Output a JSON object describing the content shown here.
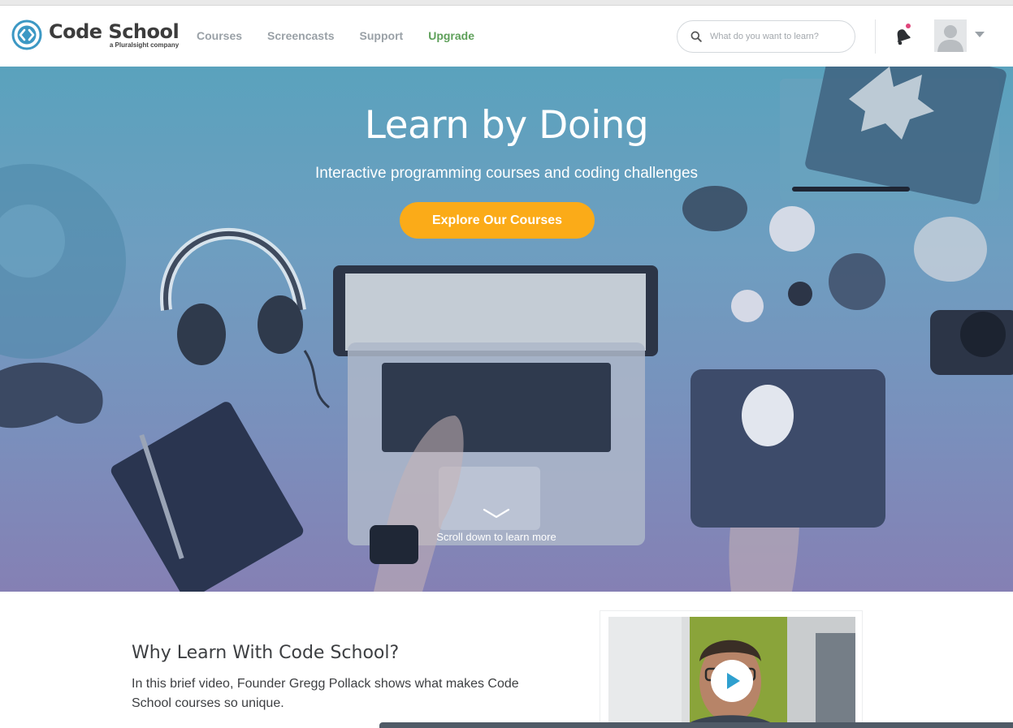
{
  "brand": {
    "name": "Code School",
    "tagline": "a Pluralsight company",
    "accent": "#3c98c4"
  },
  "nav": {
    "items": [
      {
        "label": "Courses"
      },
      {
        "label": "Screencasts"
      },
      {
        "label": "Support"
      },
      {
        "label": "Upgrade"
      }
    ],
    "upgrade_color": "#5ea05a"
  },
  "search": {
    "placeholder": "What do you want to learn?",
    "value": ""
  },
  "icons": {
    "search": "search-icon",
    "notifications": "bell-icon",
    "avatar": "user-avatar-icon",
    "menu": "caret-down-icon",
    "scroll": "chevron-down-icon",
    "play": "play-icon"
  },
  "hero": {
    "title": "Learn by Doing",
    "subtitle": "Interactive programming courses and coding challenges",
    "cta_label": "Explore Our Courses",
    "cta_color": "#fbab18",
    "scroll_hint": "Scroll down to learn more"
  },
  "why": {
    "title": "Why Learn With Code School?",
    "body": "In this brief video, Founder Gregg Pollack shows what makes Code School courses so unique."
  }
}
